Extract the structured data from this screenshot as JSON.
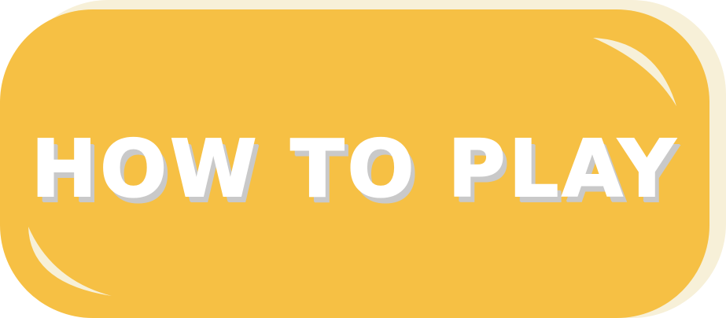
{
  "button": {
    "label": "HOW TO PLAY",
    "face_color": "#f6c044",
    "back_color": "#f7f0d8",
    "highlight_color": "#f7f0d8",
    "text_color": "#ffffff",
    "shadow_color": "#c9c9c9"
  }
}
